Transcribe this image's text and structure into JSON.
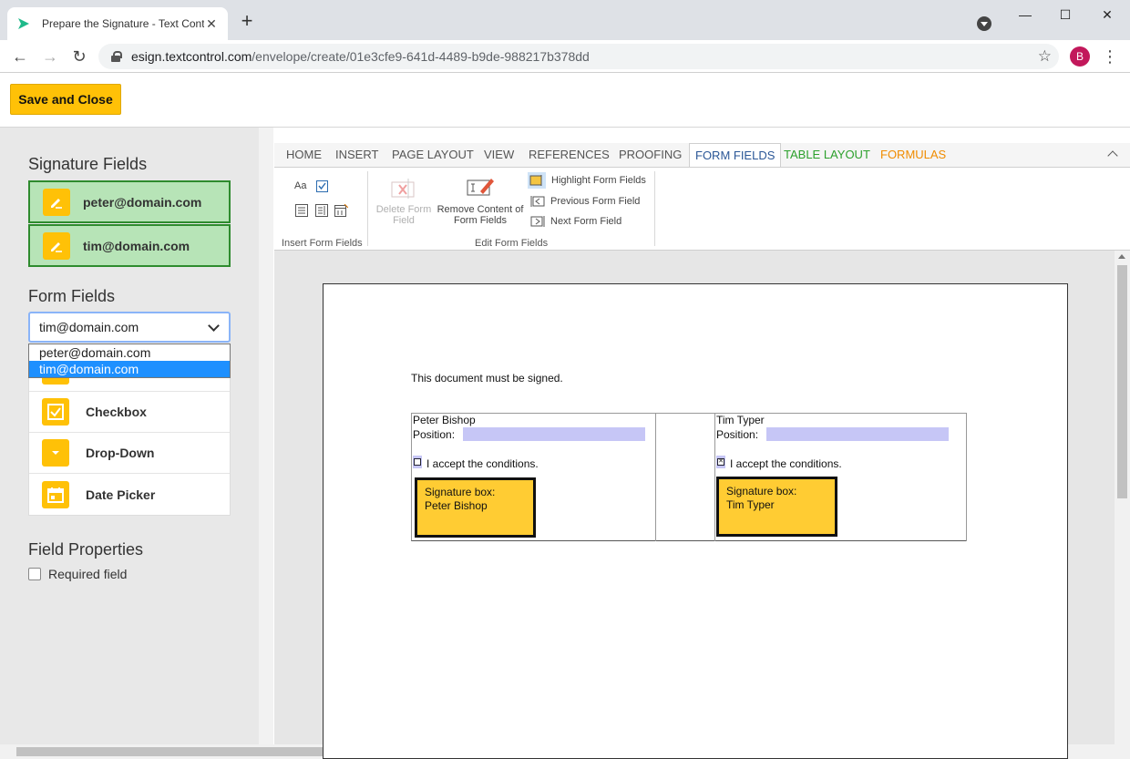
{
  "browser": {
    "tab_title": "Prepare the Signature - Text Cont",
    "url_host": "esign.textcontrol.com",
    "url_path": "/envelope/create/01e3cfe9-641d-4489-b9de-988217b378dd",
    "avatar_letter": "B"
  },
  "header": {
    "save_label": "Save and Close"
  },
  "sidebar": {
    "signature_title": "Signature Fields",
    "signature_fields": [
      "peter@domain.com",
      "tim@domain.com"
    ],
    "form_title": "Form Fields",
    "select_value": "tim@domain.com",
    "dropdown_options": [
      "peter@domain.com",
      "tim@domain.com"
    ],
    "form_items": [
      "Checkbox",
      "Drop-Down",
      "Date Picker"
    ],
    "properties_title": "Field Properties",
    "required_label": "Required field"
  },
  "ribbon": {
    "tabs": [
      "HOME",
      "INSERT",
      "PAGE LAYOUT",
      "VIEW",
      "REFERENCES",
      "PROOFING",
      "FORM FIELDS",
      "TABLE LAYOUT",
      "FORMULAS"
    ],
    "active_tab": "FORM FIELDS",
    "insert_group_label": "Insert Form Fields",
    "edit_group_label": "Edit Form Fields",
    "delete_label_1": "Delete Form",
    "delete_label_2": "Field",
    "remove_label_1": "Remove Content of",
    "remove_label_2": "Form Fields",
    "highlight_label": "Highlight Form Fields",
    "previous_label": "Previous Form Field",
    "next_label": "Next Form Field",
    "insert_text_glyph": "Aa"
  },
  "document": {
    "intro": "This document must be signed.",
    "left": {
      "name": "Peter Bishop",
      "position_label": "Position:",
      "accept": "I accept the conditions.",
      "sig_title": "Signature box:",
      "sig_name": "Peter Bishop"
    },
    "right": {
      "name": "Tim Typer",
      "position_label": "Position:",
      "accept": "I accept the conditions.",
      "sig_title": "Signature box:",
      "sig_name": "Tim Typer"
    }
  },
  "colors": {
    "accent": "#ffc107",
    "signature_bg": "#b7e4b7",
    "signature_border": "#2e8b2e",
    "field_highlight": "#c6c6f6",
    "selected_option": "#1e90ff"
  }
}
